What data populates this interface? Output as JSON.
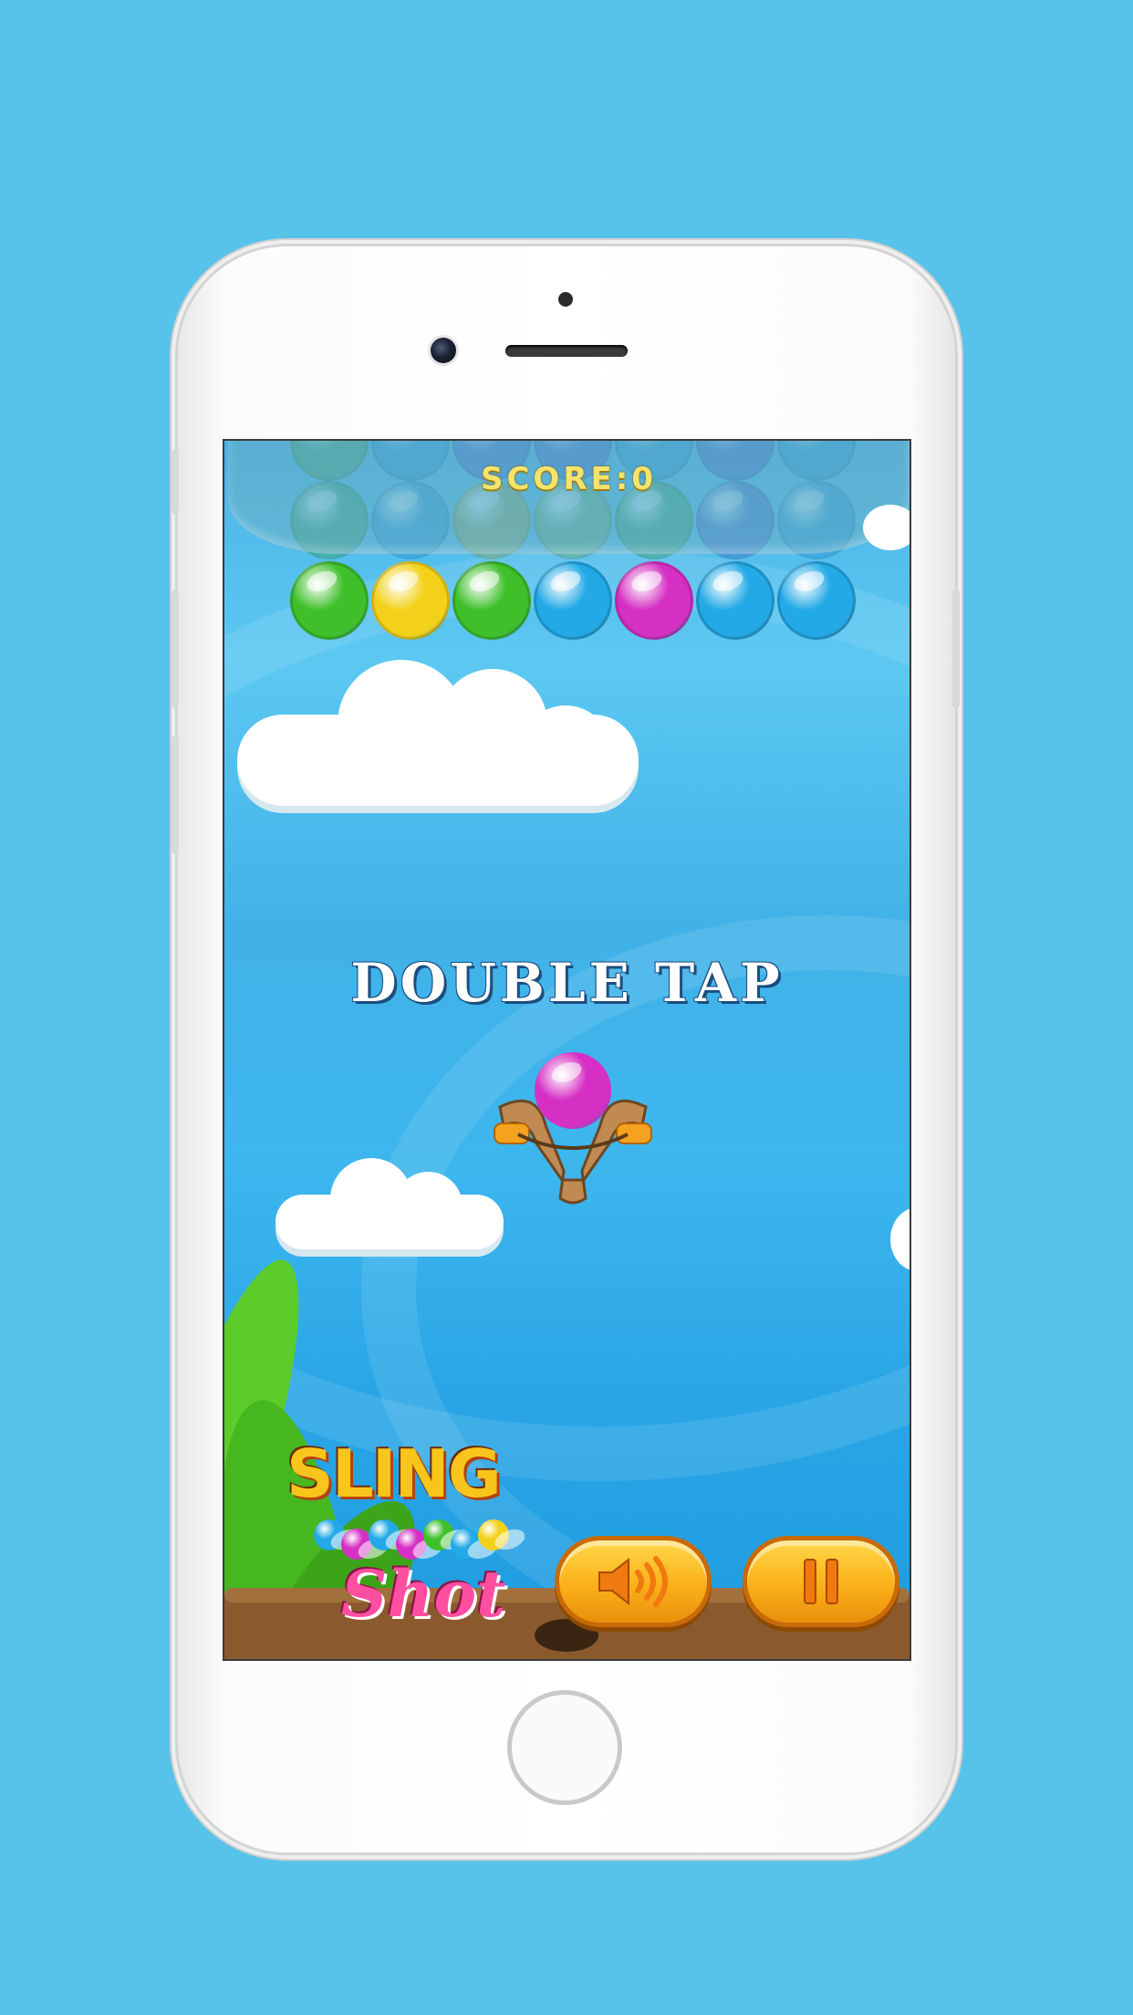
{
  "hud": {
    "score_label": "SCORE:0"
  },
  "prompt": {
    "text": "DOUBLE TAP"
  },
  "logo": {
    "line1": "SLING",
    "line2": "Shot"
  },
  "buttons": {
    "sound": "sound-on-icon",
    "pause": "pause-icon"
  },
  "bubbles": {
    "row_top": [
      "#3a9c4a",
      "#1e8fd6",
      "#3b5fcc",
      "#3b5fcc",
      "#1e8fd6",
      "#3b5fcc",
      "#1e8fd6"
    ],
    "row_middle": [
      "#2f9a4a",
      "#1e8fd6",
      "#9aa13c",
      "#6aa85a",
      "#2f9a4a",
      "#3b5fcc",
      "#1e8fd6"
    ],
    "row_visible": [
      "green",
      "yellow",
      "green",
      "blue",
      "magenta",
      "blue",
      "blue"
    ],
    "loaded": "magenta"
  },
  "colors": {
    "background": "#58c3ea",
    "green": "#3fc02b",
    "yellow": "#f3d11a",
    "blue": "#22a9e6",
    "magenta": "#d62fc4",
    "button": "#fbb01a"
  }
}
